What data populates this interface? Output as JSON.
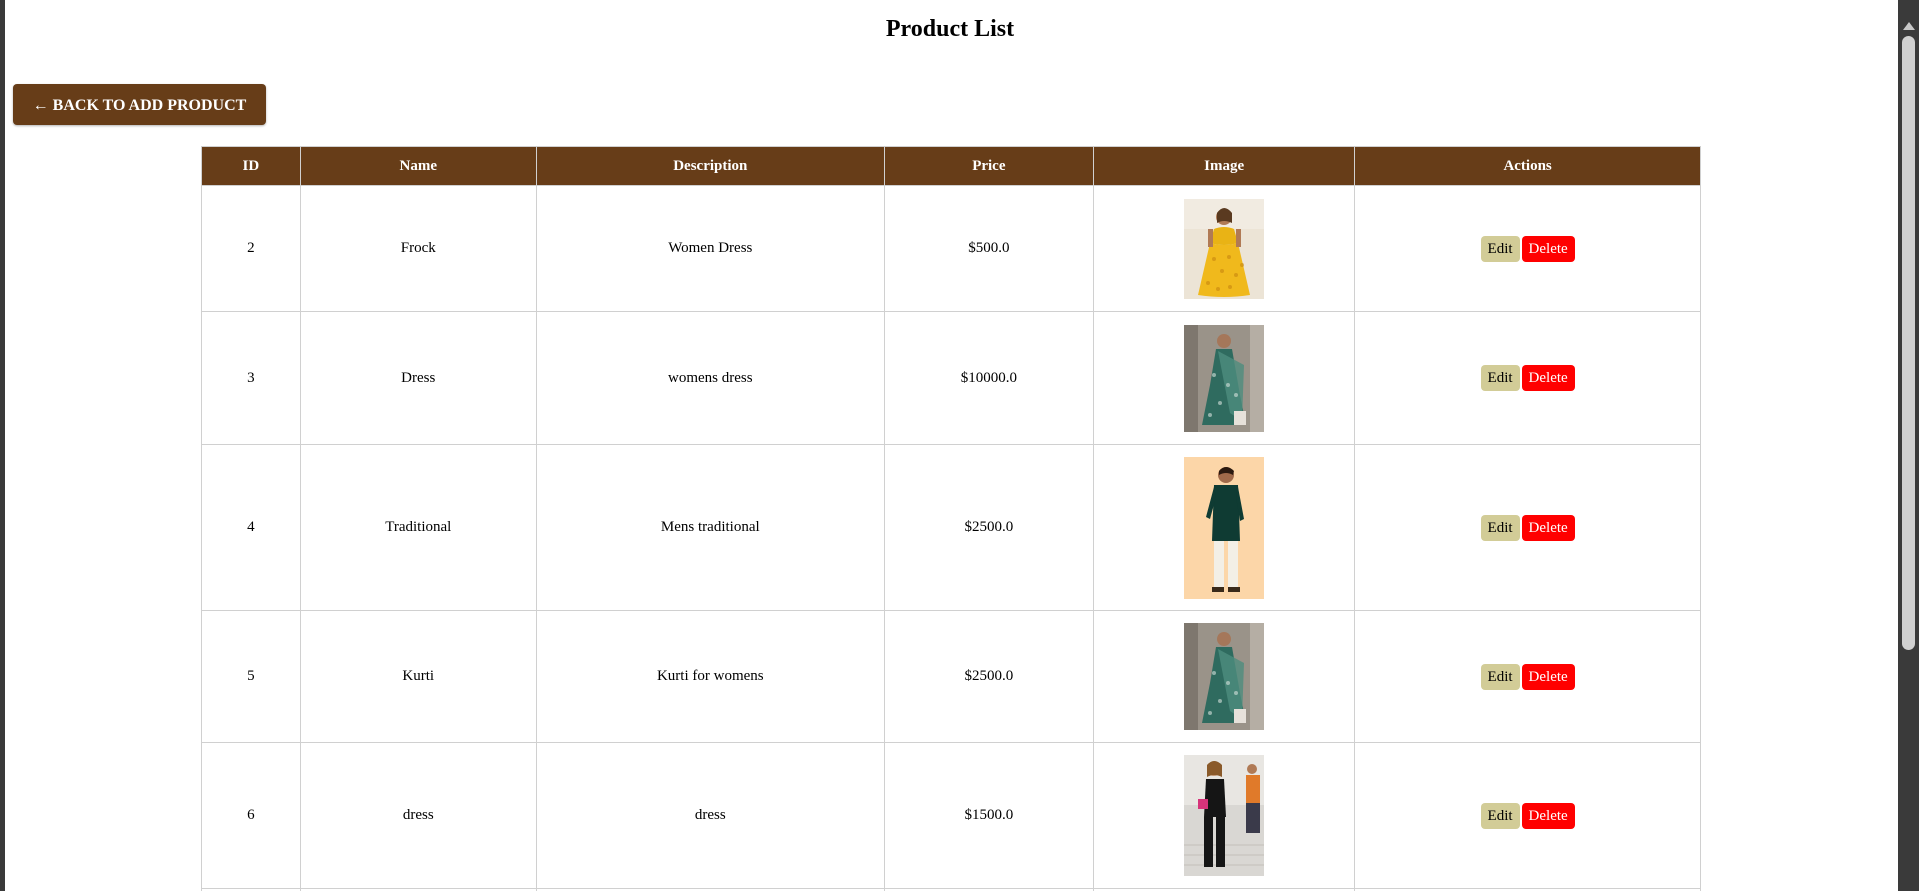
{
  "page": {
    "title": "Product List",
    "back_label": "← BACK TO ADD PRODUCT"
  },
  "table": {
    "headers": [
      "ID",
      "Name",
      "Description",
      "Price",
      "Image",
      "Actions"
    ],
    "edit_label": "Edit",
    "delete_label": "Delete",
    "rows": [
      {
        "id": "2",
        "name": "Frock",
        "description": "Women Dress",
        "price": "$500.0"
      },
      {
        "id": "3",
        "name": "Dress",
        "description": "womens dress",
        "price": "$10000.0"
      },
      {
        "id": "4",
        "name": "Traditional",
        "description": "Mens traditional",
        "price": "$2500.0"
      },
      {
        "id": "5",
        "name": "Kurti",
        "description": "Kurti for womens",
        "price": "$2500.0"
      },
      {
        "id": "6",
        "name": "dress",
        "description": "dress",
        "price": "$1500.0"
      }
    ]
  },
  "colors": {
    "header_bg": "#673d18",
    "edit_bg": "#d2cc97",
    "delete_bg": "#ff0000"
  }
}
